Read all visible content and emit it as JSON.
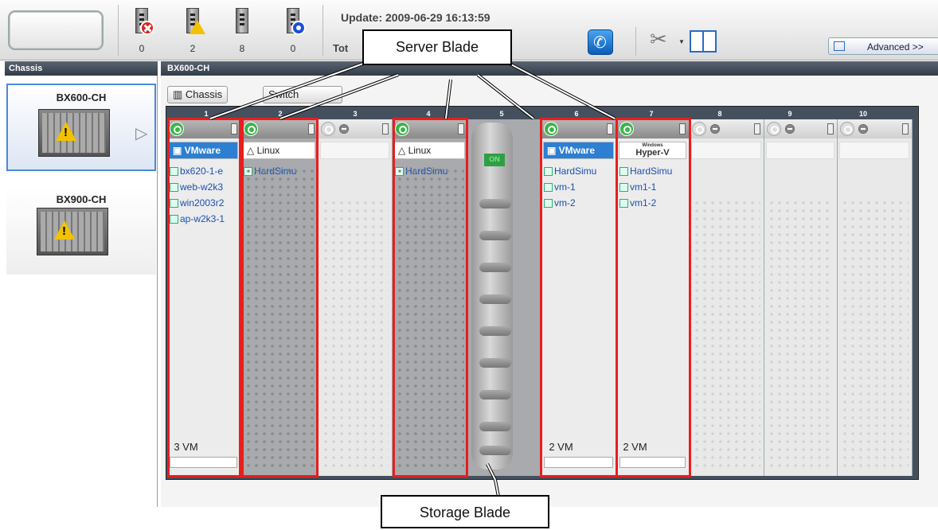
{
  "toolbar": {
    "status": [
      {
        "label": "0",
        "icon": "error-icon"
      },
      {
        "label": "2",
        "icon": "warning-icon"
      },
      {
        "label": "8",
        "icon": "normal-icon"
      },
      {
        "label": "0",
        "icon": "stop-icon"
      }
    ],
    "update": "Update: 2009-06-29 16:13:59",
    "total": "Tot",
    "advanced": "Advanced >>"
  },
  "left": {
    "header": "Chassis",
    "items": [
      {
        "label": "BX600-CH"
      },
      {
        "label": "BX900-CH"
      }
    ]
  },
  "main": {
    "header": "BX600-CH",
    "btn_chassis": "Chassis",
    "btn_switch": "Switch",
    "slots": [
      {
        "num": "1",
        "os": "VMware",
        "rows": [
          "bx620-1-e",
          "web-w2k3",
          "win2003r2",
          "ap-w2k3-1"
        ],
        "vm": "3 VM"
      },
      {
        "num": "2",
        "os": "Linux",
        "rows": [
          "HardSimu"
        ],
        "vm": ""
      },
      {
        "num": "3",
        "os": "",
        "rows": [],
        "vm": ""
      },
      {
        "num": "4",
        "os": "Linux",
        "rows": [
          "HardSimu"
        ],
        "vm": ""
      },
      {
        "num": "5",
        "os": "",
        "rows": [],
        "vm": ""
      },
      {
        "num": "6",
        "os": "VMware",
        "rows": [
          "HardSimu",
          "vm-1",
          "vm-2"
        ],
        "vm": "2 VM"
      },
      {
        "num": "7",
        "os": "Hyper-V",
        "os_small": "Windows",
        "rows": [
          "HardSimu",
          "vm1-1",
          "vm1-2"
        ],
        "vm": "2 VM"
      },
      {
        "num": "8",
        "os": "",
        "rows": [],
        "vm": ""
      },
      {
        "num": "9",
        "os": "",
        "rows": [],
        "vm": ""
      },
      {
        "num": "10",
        "os": "",
        "rows": [],
        "vm": ""
      }
    ],
    "storage_on": "ON"
  },
  "callouts": {
    "server_blade": "Server Blade",
    "storage_blade": "Storage Blade"
  },
  "colors": {
    "annotation": "#e81e1e",
    "header": "#3b4552",
    "power_on": "#3bb54a"
  }
}
